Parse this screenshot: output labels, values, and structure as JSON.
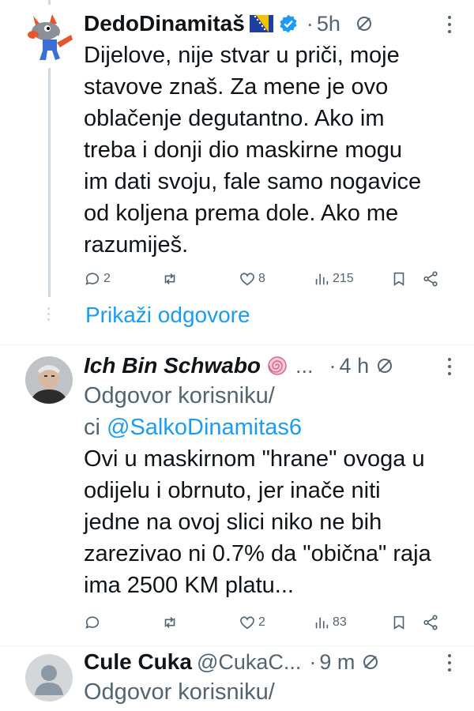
{
  "tweets": [
    {
      "name": "DedoDinamitaš",
      "time": "5h",
      "text_lines": [
        "Dijelove, nije stvar u priči, moje",
        "stavove znaš. Za mene je ovo",
        "oblačenje degutantno. Ako im",
        "treba i donji dio maskirne mogu",
        "im dati svoju, fale samo nogavice",
        "od koljena prema dole. Ako me",
        "razumiješ."
      ],
      "replies": "2",
      "retweets": "",
      "likes": "8",
      "views": "215",
      "show_replies": "Prikaži odgovore"
    },
    {
      "name": "Ich Bin Schwabo",
      "handle": "...",
      "time": "4 h",
      "reply_prefix": "Odgovor korisniku/",
      "reply_prefix2": "ci",
      "reply_handle": "@SalkoDinamitas6",
      "text_lines": [
        "Ovi u maskirnom \"hrane\" ovoga u",
        "odijelu i obrnuto, jer inače niti",
        "jedne na ovoj slici niko ne bih",
        "zarezivao ni 0.7% da \"obična\" raja",
        "ima 2500 KM platu..."
      ],
      "replies": "",
      "retweets": "",
      "likes": "2",
      "views": "83"
    },
    {
      "name": "Cule Cuka",
      "handle": "@CukaC...",
      "time": "9 m",
      "reply_prefix": "Odgovor korisniku/"
    }
  ],
  "colors": {
    "link": "#1d9bf0",
    "verified": "#1d9bf0",
    "muted": "#536471"
  },
  "icons": [
    "reply-icon",
    "retweet-icon",
    "like-icon",
    "views-icon",
    "bookmark-icon",
    "share-icon",
    "grok-icon",
    "more-icon",
    "verified-badge-icon",
    "bosnia-flag-icon"
  ]
}
